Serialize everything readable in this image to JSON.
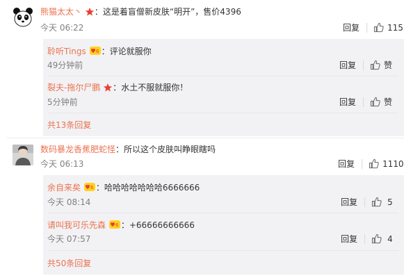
{
  "comments": [
    {
      "user": "熊猫太太丶",
      "separator": "：",
      "text": "这是着盲僧新皮肤“明开”，售价4396",
      "time": "今天 06:22",
      "reply_label": "回复",
      "likes": "115",
      "replies": [
        {
          "user": "聆听Tings",
          "separator": "：",
          "text": "评论就服你",
          "time": "49分钟前",
          "reply_label": "回复",
          "likes": "赞"
        },
        {
          "user": "裂夫-拖尔尸鹏",
          "separator": "：",
          "text": "水土不服就服你！",
          "time": "5分钟前",
          "reply_label": "回复",
          "likes": "赞"
        }
      ],
      "more": "共13条回复"
    },
    {
      "user": "数码暴龙香蕉肥蛇怪",
      "separator": "：",
      "text": "所以这个皮肤叫睁眼瞎吗",
      "time": "今天 06:13",
      "reply_label": "回复",
      "likes": "1110",
      "replies": [
        {
          "user": "余自来矣",
          "separator": "：",
          "text": "哈哈哈哈哈哈哈6666666",
          "time": "今天 08:14",
          "reply_label": "回复",
          "likes": "5"
        },
        {
          "user": "请叫我可乐先森",
          "separator": "：",
          "text": "+66666666666",
          "time": "今天 07:57",
          "reply_label": "回复",
          "likes": "4"
        }
      ],
      "more": "共50条回复"
    }
  ],
  "colors": {
    "username": "#eb7350",
    "text": "#333333",
    "time": "#808080",
    "reply_bg": "#f2f2f5"
  }
}
